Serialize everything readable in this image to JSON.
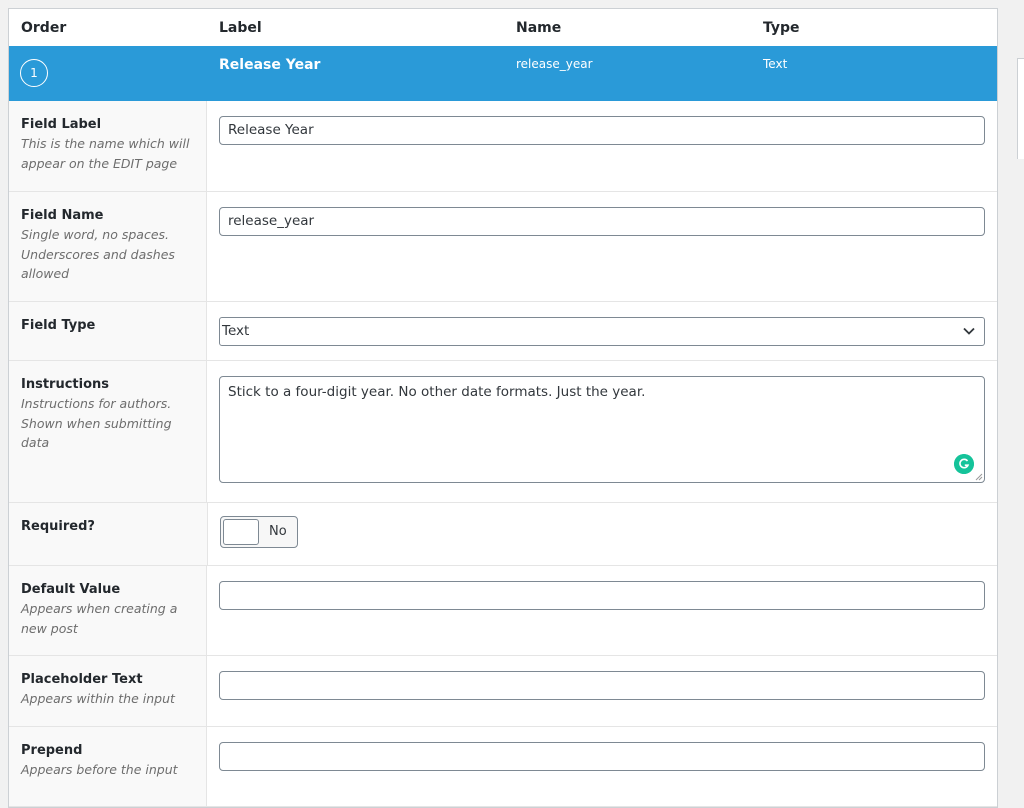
{
  "table_header": {
    "order": "Order",
    "label": "Label",
    "name": "Name",
    "type": "Type"
  },
  "field": {
    "order": "1",
    "label": "Release Year",
    "name": "release_year",
    "type": "Text"
  },
  "rows": {
    "field_label": {
      "title": "Field Label",
      "desc": "This is the name which will appear on the EDIT page",
      "value": "Release Year"
    },
    "field_name": {
      "title": "Field Name",
      "desc": "Single word, no spaces. Underscores and dashes allowed",
      "value": "release_year"
    },
    "field_type": {
      "title": "Field Type",
      "value": "Text"
    },
    "instructions": {
      "title": "Instructions",
      "desc": "Instructions for authors. Shown when submitting data",
      "value": "Stick to a four-digit year. No other date formats. Just the year."
    },
    "required": {
      "title": "Required?",
      "toggle_label": "No"
    },
    "default_value": {
      "title": "Default Value",
      "desc": "Appears when creating a new post",
      "value": ""
    },
    "placeholder_text": {
      "title": "Placeholder Text",
      "desc": "Appears within the input",
      "value": ""
    },
    "prepend": {
      "title": "Prepend",
      "desc": "Appears before the input",
      "value": ""
    }
  },
  "colors": {
    "accent": "#2a9ad8",
    "grammarly": "#15c39a"
  },
  "icons": {
    "select": "chevron-down-icon",
    "grammarly": "grammarly-icon"
  }
}
